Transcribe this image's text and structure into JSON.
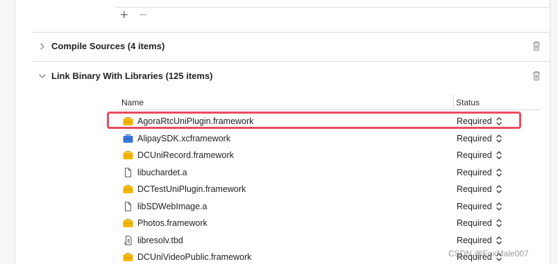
{
  "toolbar": {
    "add_label": "+",
    "remove_label": "−"
  },
  "phases": {
    "compile_sources": {
      "title": "Compile Sources (4 items)",
      "expanded": false
    },
    "link_binary": {
      "title": "Link Binary With Libraries (125 items)",
      "expanded": true
    }
  },
  "table": {
    "headers": {
      "name": "Name",
      "status": "Status"
    },
    "rows": [
      {
        "icon": "framework-toolbox-icon",
        "name": "AgoraRtcUniPlugin.framework",
        "status": "Required"
      },
      {
        "icon": "xcframework-toolbox-icon",
        "name": "AlipaySDK.xcframework",
        "status": "Required"
      },
      {
        "icon": "framework-toolbox-icon",
        "name": "DCUniRecord.framework",
        "status": "Required"
      },
      {
        "icon": "file-icon",
        "name": "libuchardet.a",
        "status": "Required"
      },
      {
        "icon": "framework-toolbox-icon",
        "name": "DCTestUniPlugin.framework",
        "status": "Required"
      },
      {
        "icon": "file-icon",
        "name": "libSDWebImage.a",
        "status": "Required"
      },
      {
        "icon": "framework-toolbox-icon",
        "name": "Photos.framework",
        "status": "Required"
      },
      {
        "icon": "tbd-file-icon",
        "name": "libresolv.tbd",
        "status": "Required"
      },
      {
        "icon": "framework-toolbox-icon",
        "name": "DCUniVideoPublic.framework",
        "status": "Required"
      }
    ]
  },
  "highlight_color": "#e94b5e",
  "framework_icon_color": "#f5b800",
  "xcframework_icon_color": "#3a78e0",
  "watermark": "CSDN @FoxMale007"
}
